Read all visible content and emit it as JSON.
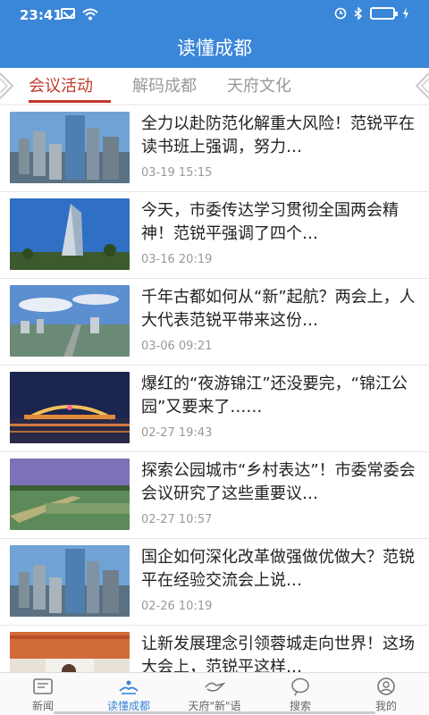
{
  "status": {
    "time": "23:41"
  },
  "header": {
    "title": "读懂成都"
  },
  "tabs": [
    {
      "label": "会议活动"
    },
    {
      "label": "解码成都"
    },
    {
      "label": "天府文化"
    }
  ],
  "colors": {
    "primary": "#3a86d8",
    "accent": "#c0392b"
  },
  "articles": [
    {
      "title": "全力以赴防范化解重大风险！范锐平在读书班上强调，努力…",
      "date": "03-19 15:15",
      "thumb": "city-skyline-blue"
    },
    {
      "title": "今天，市委传达学习贯彻全国两会精神！范锐平强调了四个…",
      "date": "03-16 20:19",
      "thumb": "tower-blue-sky"
    },
    {
      "title": "千年古都如何从“新”起航？两会上，人大代表范锐平带来这份…",
      "date": "03-06 09:21",
      "thumb": "city-aerial-clouds"
    },
    {
      "title": "爆红的“夜游锦江”还没要完，“锦江公园”又要来了……",
      "date": "02-27 19:43",
      "thumb": "night-bridge"
    },
    {
      "title": "探索公园城市“乡村表达”！市委常委会会议研究了这些重要议…",
      "date": "02-27 10:57",
      "thumb": "green-field-path"
    },
    {
      "title": "国企如何深化改革做强做优做大？范锐平在经验交流会上说…",
      "date": "02-26 10:19",
      "thumb": "city-skyline-blue"
    },
    {
      "title": "让新发展理念引领蓉城走向世界！这场大会上，范锐平这样…",
      "date": "",
      "thumb": "meeting-hall"
    }
  ],
  "bottom_nav": [
    {
      "label": "新闻",
      "icon": "news-icon"
    },
    {
      "label": "读懂成都",
      "icon": "book-icon",
      "active": true
    },
    {
      "label": "天府\"新\"语",
      "icon": "bird-icon"
    },
    {
      "label": "搜索",
      "icon": "search-icon"
    },
    {
      "label": "我的",
      "icon": "profile-icon"
    }
  ]
}
